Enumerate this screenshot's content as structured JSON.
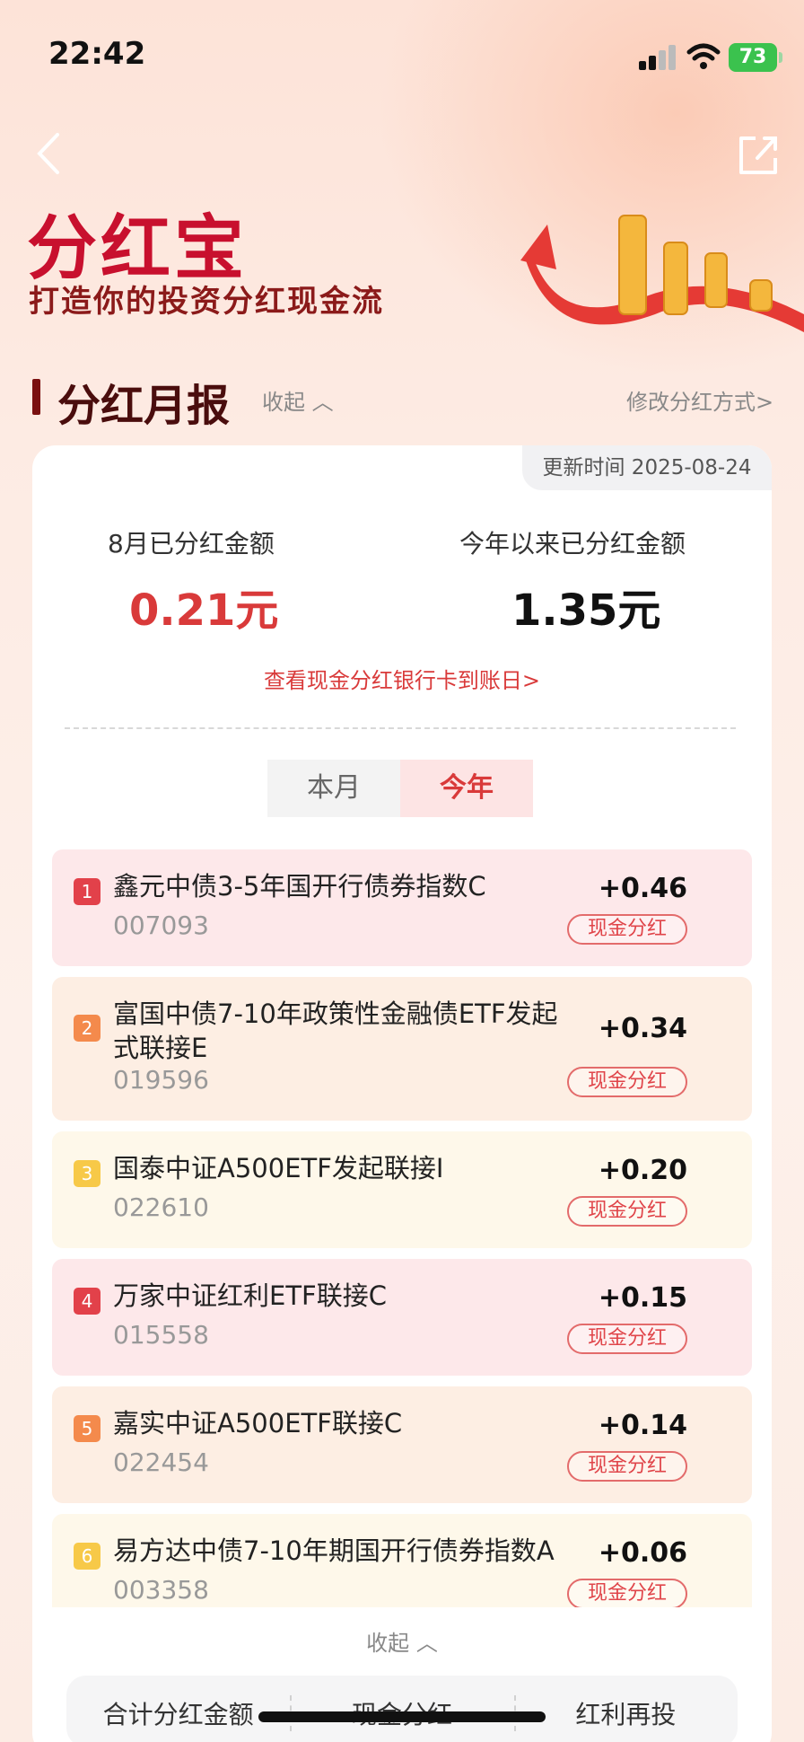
{
  "status_bar": {
    "time": "22:42",
    "battery": "73"
  },
  "brand": {
    "title": "分红宝",
    "subtitle": "打造你的投资分红现金流"
  },
  "section": {
    "title": "分红月报",
    "collapse": "收起",
    "modify": "修改分红方式>"
  },
  "report": {
    "update_time": "更新时间 2025-08-24",
    "month_label": "8月已分红金额",
    "month_value": "0.21元",
    "year_label": "今年以来已分红金额",
    "year_value": "1.35元",
    "bank_link": "查看现金分红银行卡到账日>"
  },
  "segment": {
    "month": "本月",
    "year": "今年",
    "selected": "今年"
  },
  "funds": [
    {
      "rank": "1",
      "name": "鑫元中债3-5年国开行债券指数C",
      "code": "007093",
      "amount": "+0.46",
      "tag": "现金分红"
    },
    {
      "rank": "2",
      "name": "富国中债7-10年政策性金融债ETF发起式联接E",
      "code": "019596",
      "amount": "+0.34",
      "tag": "现金分红"
    },
    {
      "rank": "3",
      "name": "国泰中证A500ETF发起联接I",
      "code": "022610",
      "amount": "+0.20",
      "tag": "现金分红"
    },
    {
      "rank": "4",
      "name": "万家中证红利ETF联接C",
      "code": "015558",
      "amount": "+0.15",
      "tag": "现金分红"
    },
    {
      "rank": "5",
      "name": "嘉实中证A500ETF联接C",
      "code": "022454",
      "amount": "+0.14",
      "tag": "现金分红"
    },
    {
      "rank": "6",
      "name": "易方达中债7-10年期国开行债券指数A",
      "code": "003358",
      "amount": "+0.06",
      "tag": "现金分红"
    }
  ],
  "colors": {
    "rank_red": "#e2414a",
    "rank_orange": "#f48a4c",
    "rank_yellow": "#f7c948",
    "bg_pink": "#fde8ea",
    "bg_peach": "#fdeee3",
    "bg_cream": "#fef8ea"
  },
  "bottom": {
    "collapse": "收起",
    "tabs": [
      "合计分红金额",
      "现金分红",
      "红利再投"
    ]
  }
}
